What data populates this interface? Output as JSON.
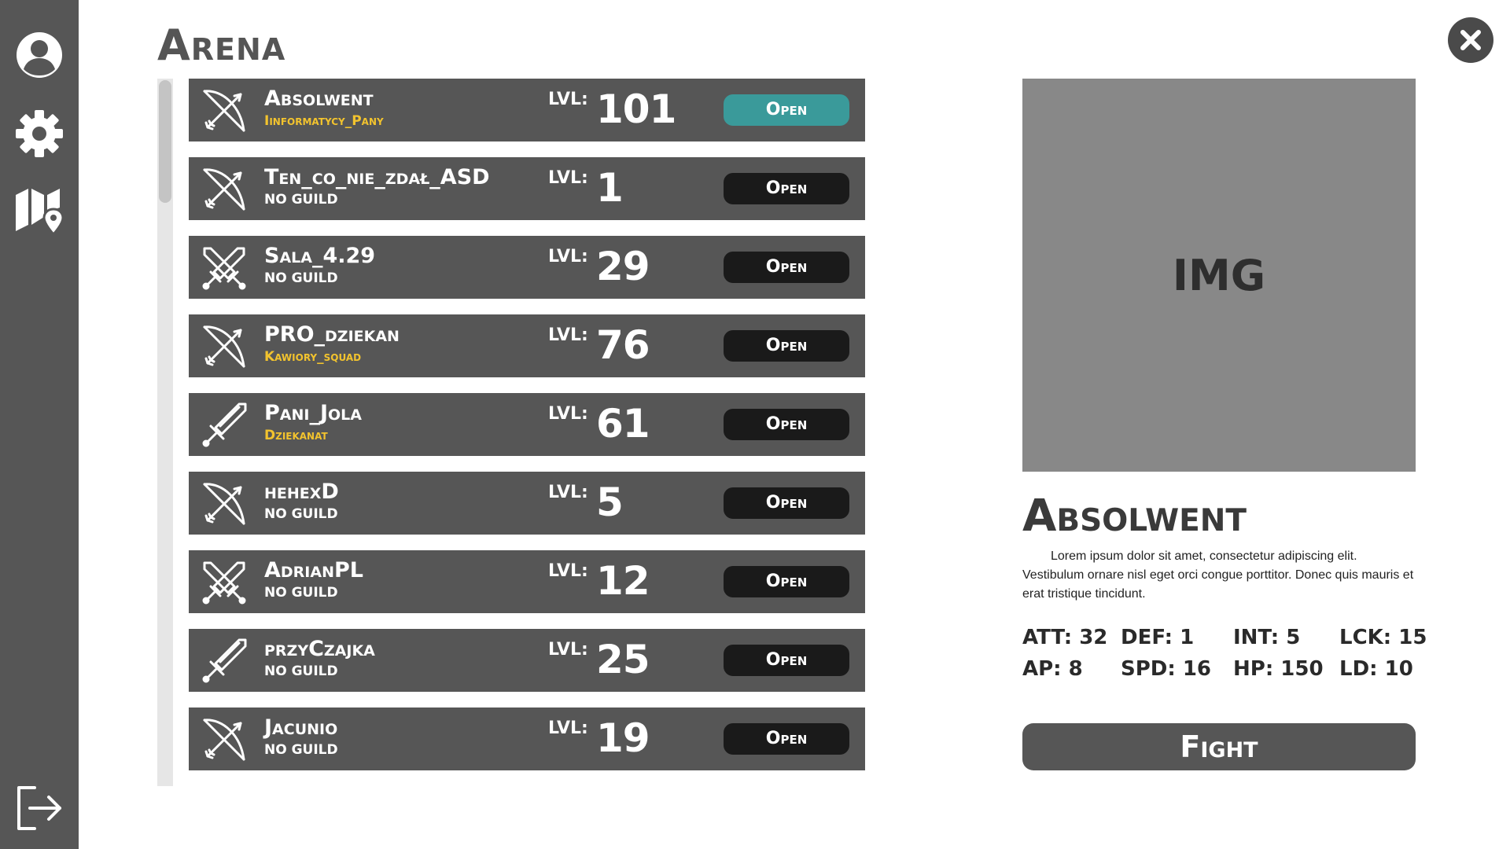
{
  "sidebar": {
    "icons": [
      "user-icon",
      "gear-icon",
      "map-icon",
      "logout-icon"
    ]
  },
  "page": {
    "title": "Arena"
  },
  "close": {
    "icon": "close-icon"
  },
  "list": {
    "level_label": "LVL:",
    "open_label": "Open",
    "rows": [
      {
        "name": "Absolwent",
        "guild": "Iinformatycy_Pany",
        "guild_highlight": true,
        "level": "101",
        "class_icon": "bow-icon",
        "selected": true
      },
      {
        "name": "Ten_co_nie_zdał_ASD",
        "guild": "NO GUILD",
        "guild_highlight": false,
        "level": "1",
        "class_icon": "bow-icon",
        "selected": false
      },
      {
        "name": "Sala_4.29",
        "guild": "NO GUILD",
        "guild_highlight": false,
        "level": "29",
        "class_icon": "crossed-swords-icon",
        "selected": false
      },
      {
        "name": "PRO_dziekan",
        "guild": "Kawiory_squad",
        "guild_highlight": true,
        "level": "76",
        "class_icon": "bow-icon",
        "selected": false
      },
      {
        "name": "Pani_Jola",
        "guild": "Dziekanat",
        "guild_highlight": true,
        "level": "61",
        "class_icon": "sword-icon",
        "selected": false
      },
      {
        "name": "hehexD",
        "guild": "NO GUILD",
        "guild_highlight": false,
        "level": "5",
        "class_icon": "bow-icon",
        "selected": false
      },
      {
        "name": "AdrianPL",
        "guild": "NO GUILD",
        "guild_highlight": false,
        "level": "12",
        "class_icon": "crossed-swords-icon",
        "selected": false
      },
      {
        "name": "przyCzajka",
        "guild": "NO GUILD",
        "guild_highlight": false,
        "level": "25",
        "class_icon": "sword-icon",
        "selected": false
      },
      {
        "name": "Jacunio",
        "guild": "NO GUILD",
        "guild_highlight": false,
        "level": "19",
        "class_icon": "bow-icon",
        "selected": false
      }
    ]
  },
  "detail": {
    "image_label": "IMG",
    "name": "Absolwent",
    "description": "Lorem ipsum dolor sit amet, consectetur adipiscing elit. Vestibulum ornare nisl eget orci congue porttitor. Donec quis mauris et erat tristique tincidunt.",
    "stats": [
      {
        "label": "ATT: 32"
      },
      {
        "label": "DEF: 1"
      },
      {
        "label": "INT: 5"
      },
      {
        "label": "LCK: 15"
      },
      {
        "label": "AP: 8"
      },
      {
        "label": "SPD: 16"
      },
      {
        "label": "HP: 150"
      },
      {
        "label": "LD: 10"
      }
    ],
    "fight_label": "Fight"
  },
  "colors": {
    "panel": "#565656",
    "open_active": "#3a9a9a",
    "open_default": "#1a1a1a",
    "guild_highlight": "#f2c32e",
    "image_placeholder": "#888888"
  }
}
